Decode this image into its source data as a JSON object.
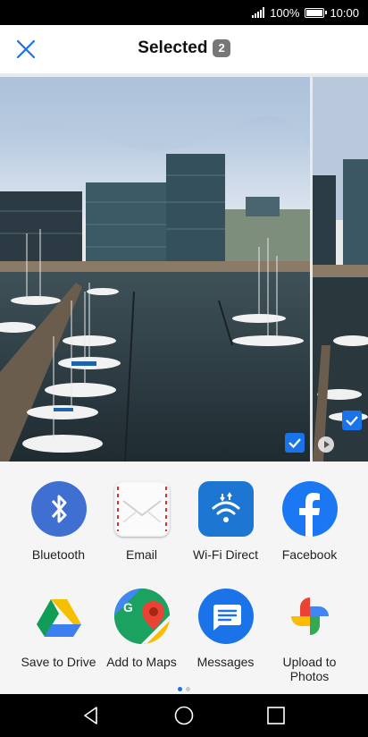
{
  "status_bar": {
    "battery": "100%",
    "time": "10:00",
    "signal_icon": "signal-bars-icon",
    "battery_icon": "battery-full-icon"
  },
  "header": {
    "title": "Selected",
    "selected_count": "2",
    "close_icon": "close-icon"
  },
  "preview": {
    "photos": [
      {
        "name": "harbour-photo-1",
        "selected": true
      },
      {
        "name": "harbour-photo-2",
        "selected": true,
        "type_indicator": "motion-photo"
      }
    ]
  },
  "share_targets": [
    {
      "label": "Bluetooth",
      "icon": "bluetooth-icon"
    },
    {
      "label": "Email",
      "icon": "email-icon"
    },
    {
      "label": "Wi-Fi Direct",
      "icon": "wifi-direct-icon"
    },
    {
      "label": "Facebook",
      "icon": "facebook-icon"
    },
    {
      "label": "Save to Drive",
      "icon": "google-drive-icon"
    },
    {
      "label": "Add to Maps",
      "icon": "google-maps-icon"
    },
    {
      "label": "Messages",
      "icon": "messages-icon"
    },
    {
      "label": "Upload to Photos",
      "icon": "google-photos-icon"
    }
  ],
  "pagination": {
    "pages": 2,
    "current": 1
  },
  "navigation": {
    "back_icon": "back-icon",
    "home_icon": "home-icon",
    "recents_icon": "recents-icon"
  },
  "colors": {
    "accent": "#1a73e8",
    "badge": "#777777",
    "panel_background": "#f5f5f5"
  }
}
